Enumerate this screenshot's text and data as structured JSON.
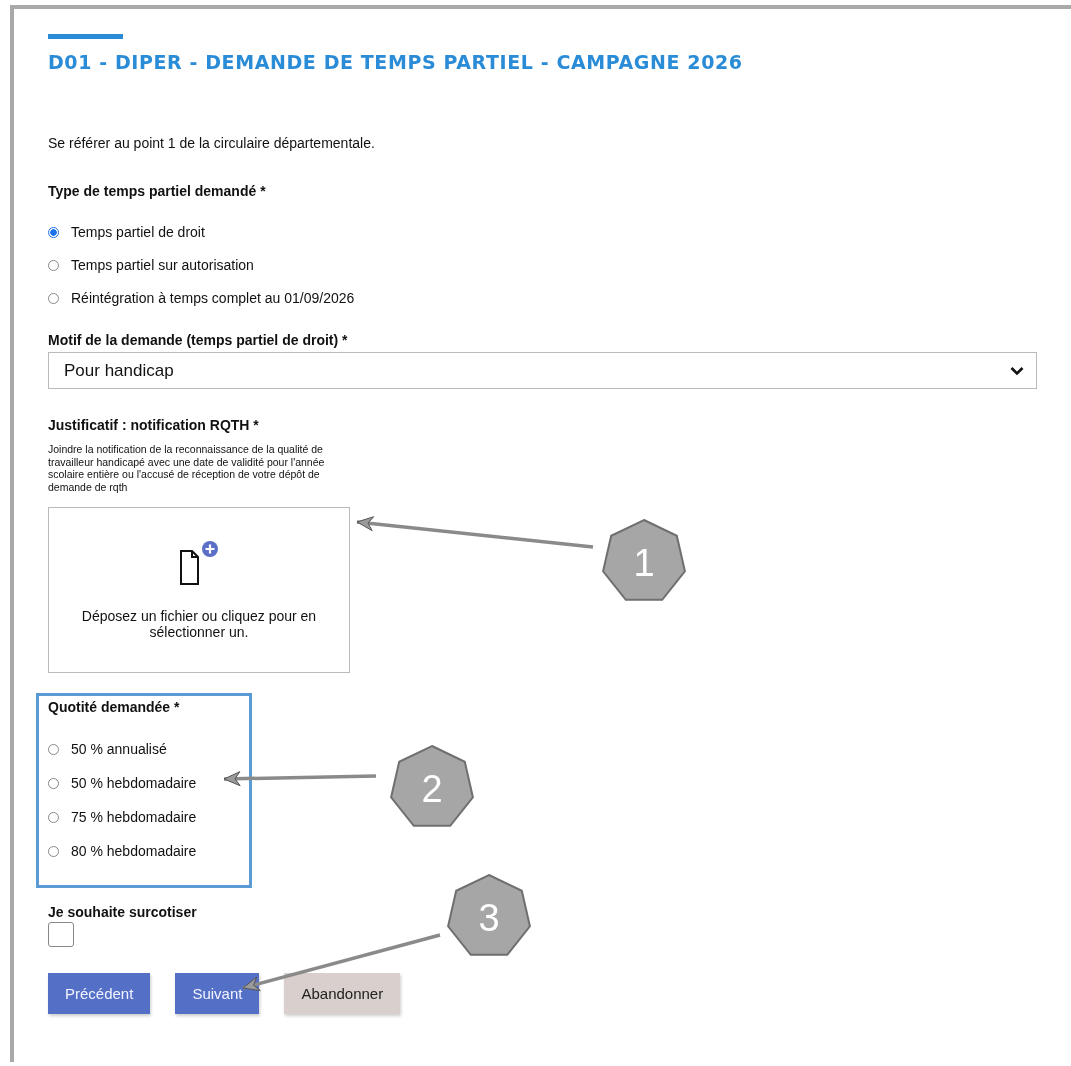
{
  "form": {
    "title": "D01 - DIPER - DEMANDE DE TEMPS PARTIEL - CAMPAGNE 2026",
    "intro": "Se référer au point 1 de la circulaire départementale.",
    "type_group": {
      "label": "Type de temps partiel demandé *",
      "options": [
        {
          "label": "Temps partiel de droit",
          "selected": true
        },
        {
          "label": "Temps partiel sur autorisation",
          "selected": false
        },
        {
          "label": "Réintégration à temps complet au 01/09/2026",
          "selected": false
        }
      ]
    },
    "motif": {
      "label": "Motif de la demande (temps partiel de droit) *",
      "value": "Pour handicap"
    },
    "justificatif": {
      "label": "Justificatif : notification RQTH *",
      "help": "Joindre la notification de la reconnaissance de la qualité de travailleur handicapé avec une date de validité pour l'année scolaire entière ou l'accusé de réception de votre dépôt de demande de rqth",
      "dropzone_text": "Déposez un fichier ou cliquez pour en sélectionner un."
    },
    "quotite": {
      "label": "Quotité demandée *",
      "highlighted": true,
      "options": [
        {
          "label": "50 % annualisé",
          "selected": false
        },
        {
          "label": "50 % hebdomadaire",
          "selected": false
        },
        {
          "label": "75 % hebdomadaire",
          "selected": false
        },
        {
          "label": "80 % hebdomadaire",
          "selected": false
        }
      ]
    },
    "surcotiser": {
      "label": "Je souhaite surcotiser",
      "checked": false
    },
    "buttons": [
      {
        "label": "Précédent",
        "kind": "primary"
      },
      {
        "label": "Suivant",
        "kind": "primary"
      },
      {
        "label": "Abandonner",
        "kind": "secondary"
      }
    ]
  },
  "callouts": [
    {
      "number": "1"
    },
    {
      "number": "2"
    },
    {
      "number": "3"
    }
  ]
}
